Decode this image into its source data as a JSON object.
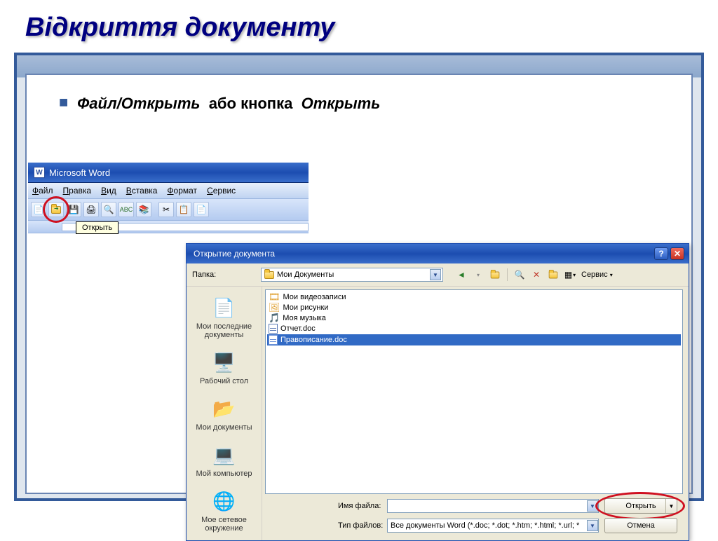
{
  "slide": {
    "title": "Відкриття документу"
  },
  "instruction": {
    "cmd": "Файл/Открыть",
    "mid": "або кнопка",
    "btn": "Открыть"
  },
  "word": {
    "title": "Microsoft Word",
    "menu": {
      "file": "Файл",
      "edit": "Правка",
      "view": "Вид",
      "insert": "Вставка",
      "format": "Формат",
      "tools": "Сервис"
    },
    "tooltip": "Открыть"
  },
  "dialog": {
    "title": "Открытие документа",
    "folder_label": "Папка:",
    "current_folder": "Мои Документы",
    "service": "Сервис",
    "places": {
      "recent": "Мои последние документы",
      "desktop": "Рабочий стол",
      "mydocs": "Мои документы",
      "mycomp": "Мой компьютер",
      "network": "Мое сетевое окружение"
    },
    "files": {
      "video": "Мои видеозаписи",
      "pictures": "Мои рисунки",
      "music": "Моя музыка",
      "report": "Отчет.doc",
      "spelling": "Правописание.doc"
    },
    "filename_label": "Имя файла:",
    "filetype_label": "Тип файлов:",
    "filetype_value": "Все документы Word (*.doc; *.dot; *.htm; *.html; *.url; *",
    "open_btn": "Открыть",
    "cancel_btn": "Отмена"
  }
}
